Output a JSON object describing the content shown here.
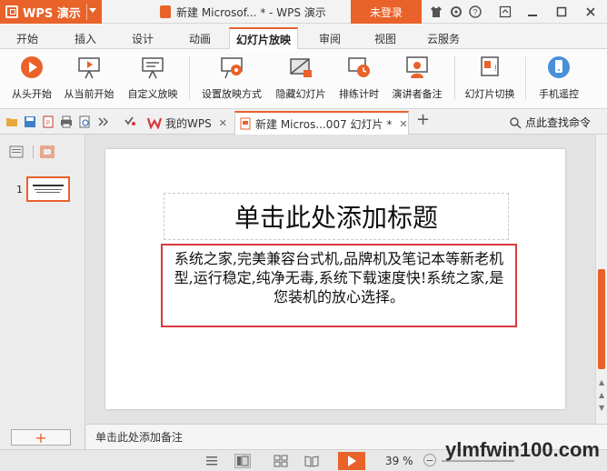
{
  "titlebar": {
    "app_name": "WPS 演示",
    "doc_title": "新建 Microsof... * - WPS 演示",
    "login": "未登录"
  },
  "ribbon_tabs": [
    "开始",
    "插入",
    "设计",
    "动画",
    "幻灯片放映",
    "审阅",
    "视图",
    "云服务"
  ],
  "active_tab_index": 4,
  "ribbon": {
    "buttons": [
      {
        "label": "从头开始",
        "icon": "play-circle-icon"
      },
      {
        "label": "从当前开始",
        "icon": "play-from-current-icon"
      },
      {
        "label": "自定义放映",
        "icon": "custom-show-icon"
      },
      {
        "label": "设置放映方式",
        "icon": "show-settings-icon"
      },
      {
        "label": "隐藏幻灯片",
        "icon": "hide-slide-icon"
      },
      {
        "label": "排练计时",
        "icon": "rehearse-timing-icon"
      },
      {
        "label": "演讲者备注",
        "icon": "presenter-notes-icon"
      },
      {
        "label": "幻灯片切换",
        "icon": "slide-transition-icon"
      },
      {
        "label": "手机遥控",
        "icon": "phone-remote-icon"
      }
    ]
  },
  "doc_tabs": [
    {
      "label": "我的WPS",
      "icon": "wps-logo-icon"
    },
    {
      "label": "新建 Micros...007 幻灯片 *",
      "icon": "ppt-doc-icon"
    }
  ],
  "search": {
    "label": "点此查找命令"
  },
  "slide_panel": {
    "slide_number": "1"
  },
  "slide": {
    "title_placeholder": "单击此处添加标题",
    "body_text": "系统之家,完美兼容台式机,品牌机及笔记本等新老机型,运行稳定,纯净无毒,系统下载速度快!系统之家,是您装机的放心选择。"
  },
  "notes_placeholder": "单击此处添加备注",
  "status": {
    "zoom": "39 %"
  },
  "watermark": "ylmfwin100.com",
  "colors": {
    "accent": "#e8622a",
    "highlight_border": "#d9393e"
  }
}
